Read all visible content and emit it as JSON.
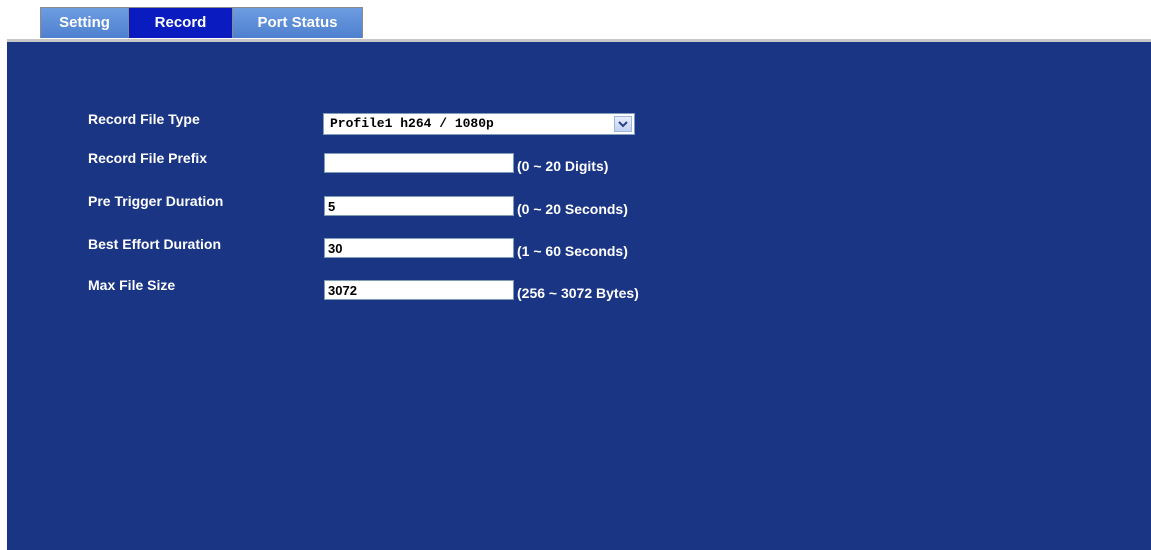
{
  "tabs": {
    "setting": "Setting",
    "record": "Record",
    "port_status": "Port Status"
  },
  "form": {
    "record_file_type": {
      "label": "Record File Type",
      "value": "Profile1 h264 / 1080p"
    },
    "record_file_prefix": {
      "label": "Record File Prefix",
      "value": "",
      "hint": "(0 ~ 20 Digits)"
    },
    "pre_trigger_duration": {
      "label": "Pre Trigger Duration",
      "value": "5",
      "hint": "(0 ~ 20 Seconds)"
    },
    "best_effort_duration": {
      "label": "Best Effort Duration",
      "value": "30",
      "hint": "(1 ~ 60 Seconds)"
    },
    "max_file_size": {
      "label": "Max File Size",
      "value": "3072",
      "hint": "(256 ~ 3072 Bytes)"
    }
  },
  "colors": {
    "panel_background": "#1b3585",
    "tab_active": "#0a1cbf",
    "tab_inactive": "#5f8fd6"
  },
  "icons": {
    "dropdown": "chevron-down-icon"
  }
}
